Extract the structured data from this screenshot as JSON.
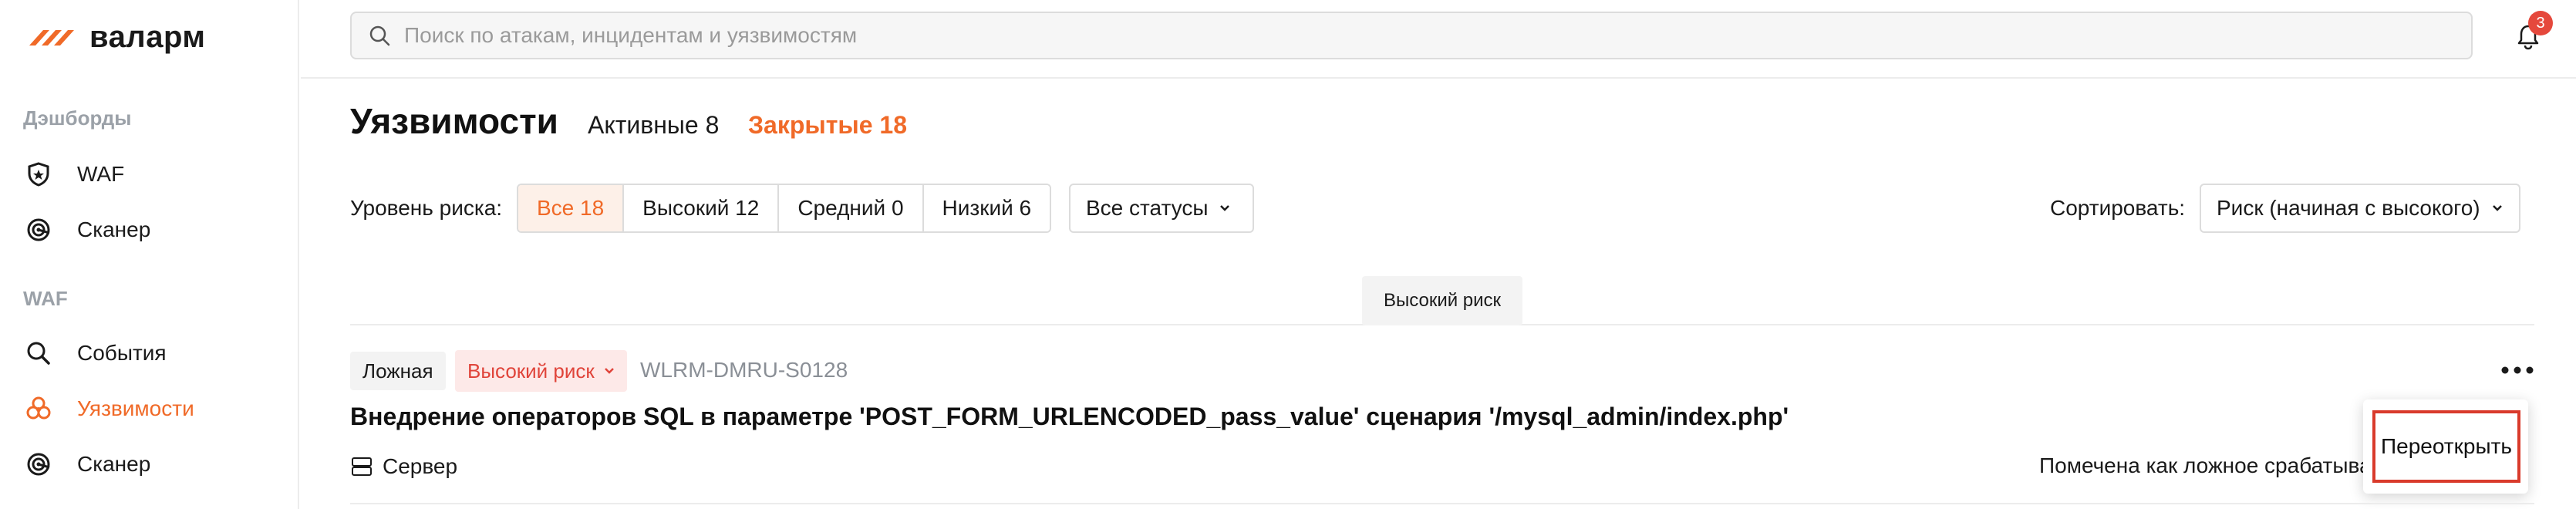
{
  "brand": {
    "name": "валарм",
    "accent": "#f06a28"
  },
  "sidebar": {
    "group_dashboards": "Дэшборды",
    "group_waf": "WAF",
    "items": [
      {
        "label": "WAF",
        "icon": "shield-icon"
      },
      {
        "label": "Сканер",
        "icon": "scanner-icon"
      },
      {
        "label": "События",
        "icon": "search-icon"
      },
      {
        "label": "Уязвимости",
        "icon": "biohazard-icon",
        "active": true
      },
      {
        "label": "Сканер",
        "icon": "scanner-icon"
      }
    ]
  },
  "header": {
    "search_placeholder": "Поиск по атакам, инцидентам и уязвимостям",
    "notifications_count": "3"
  },
  "page": {
    "title": "Уязвимости",
    "tab_active": "Активные 8",
    "tab_closed": "Закрытые 18"
  },
  "filters": {
    "risk_label": "Уровень риска:",
    "risk_options": [
      "Все 18",
      "Высокий 12",
      "Средний 0",
      "Низкий 6"
    ],
    "selected_risk": "Все 18",
    "status_select": "Все статусы",
    "sort_label": "Сортировать:",
    "sort_select": "Риск (начиная с высокого)"
  },
  "group_header": "Высокий риск",
  "vulnerability": {
    "tag_false": "Ложная",
    "risk": "Высокий риск",
    "id": "WLRM-DMRU-S0128",
    "title": "Внедрение операторов SQL в параметре 'POST_FORM_URLENCODED_pass_value' сценария '/mysql_admin/index.php'",
    "target": "Сервер",
    "status": "Помечена как ложное срабатывание"
  },
  "context_menu": {
    "reopen": "Переоткрыть"
  }
}
